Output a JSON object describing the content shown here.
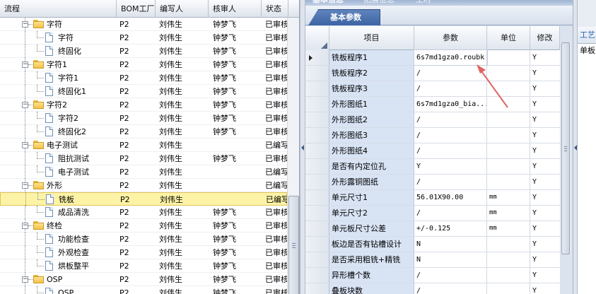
{
  "tree": {
    "columns": [
      "流程",
      "BOM工厂",
      "编写人",
      "核审人",
      "状态"
    ],
    "rows": [
      {
        "level": 1,
        "kind": "folder",
        "name": "字符",
        "bom": "P2",
        "writer": "刘伟生",
        "reviewer": "钟梦飞",
        "status": "已审核"
      },
      {
        "level": 2,
        "kind": "doc",
        "name": "字符",
        "bom": "P2",
        "writer": "刘伟生",
        "reviewer": "钟梦飞",
        "status": "已审核"
      },
      {
        "level": 2,
        "kind": "doc",
        "name": "终固化",
        "bom": "P2",
        "writer": "刘伟生",
        "reviewer": "钟梦飞",
        "status": "已审核"
      },
      {
        "level": 1,
        "kind": "folder",
        "name": "字符1",
        "bom": "P2",
        "writer": "刘伟生",
        "reviewer": "钟梦飞",
        "status": "已审核"
      },
      {
        "level": 2,
        "kind": "doc",
        "name": "字符1",
        "bom": "P2",
        "writer": "刘伟生",
        "reviewer": "钟梦飞",
        "status": "已审核"
      },
      {
        "level": 2,
        "kind": "doc",
        "name": "终固化1",
        "bom": "P2",
        "writer": "刘伟生",
        "reviewer": "钟梦飞",
        "status": "已审核"
      },
      {
        "level": 1,
        "kind": "folder",
        "name": "字符2",
        "bom": "P2",
        "writer": "刘伟生",
        "reviewer": "钟梦飞",
        "status": "已审核"
      },
      {
        "level": 2,
        "kind": "doc",
        "name": "字符2",
        "bom": "P2",
        "writer": "刘伟生",
        "reviewer": "钟梦飞",
        "status": "已审核"
      },
      {
        "level": 2,
        "kind": "doc",
        "name": "终固化2",
        "bom": "P2",
        "writer": "刘伟生",
        "reviewer": "钟梦飞",
        "status": "已审核"
      },
      {
        "level": 1,
        "kind": "folder",
        "name": "电子测试",
        "bom": "P2",
        "writer": "刘伟生",
        "reviewer": "",
        "status": "已编写"
      },
      {
        "level": 2,
        "kind": "doc",
        "name": "阻抗测试",
        "bom": "P2",
        "writer": "刘伟生",
        "reviewer": "钟梦飞",
        "status": "已审核"
      },
      {
        "level": 2,
        "kind": "doc",
        "name": "电子测试",
        "bom": "P2",
        "writer": "刘伟生",
        "reviewer": "",
        "status": "已编写"
      },
      {
        "level": 1,
        "kind": "folder",
        "name": "外形",
        "bom": "P2",
        "writer": "刘伟生",
        "reviewer": "",
        "status": "已编写"
      },
      {
        "level": 2,
        "kind": "doc",
        "name": "铣板",
        "bom": "P2",
        "writer": "刘伟生",
        "reviewer": "",
        "status": "已编写",
        "selected": true
      },
      {
        "level": 2,
        "kind": "doc",
        "name": "成品清洗",
        "bom": "P2",
        "writer": "刘伟生",
        "reviewer": "钟梦飞",
        "status": "已审核"
      },
      {
        "level": 1,
        "kind": "folder",
        "name": "终检",
        "bom": "P2",
        "writer": "刘伟生",
        "reviewer": "钟梦飞",
        "status": "已审核"
      },
      {
        "level": 2,
        "kind": "doc",
        "name": "功能检查",
        "bom": "P2",
        "writer": "刘伟生",
        "reviewer": "钟梦飞",
        "status": "已审核"
      },
      {
        "level": 2,
        "kind": "doc",
        "name": "外观检查",
        "bom": "P2",
        "writer": "刘伟生",
        "reviewer": "钟梦飞",
        "status": "已审核"
      },
      {
        "level": 2,
        "kind": "doc",
        "name": "烘板整平",
        "bom": "P2",
        "writer": "刘伟生",
        "reviewer": "钟梦飞",
        "status": "已审核"
      },
      {
        "level": 1,
        "kind": "folder",
        "name": "OSP",
        "bom": "P2",
        "writer": "刘伟生",
        "reviewer": "钟梦飞",
        "status": "已审核"
      },
      {
        "level": 2,
        "kind": "doc",
        "name": "OSP",
        "bom": "P2",
        "writer": "刘伟生",
        "reviewer": "钟梦飞",
        "status": "已审核"
      }
    ]
  },
  "right": {
    "tabs": [
      "基本信息",
      "拓展信息",
      "工时"
    ],
    "subtab": "基本参数",
    "columns": [
      "项目",
      "参数",
      "单位",
      "修改"
    ],
    "rows": [
      {
        "item": "铣板程序1",
        "param": "6s7md1gza0.roubk",
        "unit": "",
        "mod": "Y",
        "current": true
      },
      {
        "item": "铣板程序2",
        "param": "/",
        "unit": "",
        "mod": "Y"
      },
      {
        "item": "铣板程序3",
        "param": "/",
        "unit": "",
        "mod": "Y"
      },
      {
        "item": "外形图纸1",
        "param": "6s7md1gza0_bia...",
        "unit": "",
        "mod": "Y"
      },
      {
        "item": "外形图纸2",
        "param": "/",
        "unit": "",
        "mod": "Y"
      },
      {
        "item": "外形图纸3",
        "param": "/",
        "unit": "",
        "mod": "Y"
      },
      {
        "item": "外形图纸4",
        "param": "/",
        "unit": "",
        "mod": "Y"
      },
      {
        "item": "是否有内定位孔",
        "param": "Y",
        "unit": "",
        "mod": "Y"
      },
      {
        "item": "外形露铜图纸",
        "param": "/",
        "unit": "",
        "mod": "Y"
      },
      {
        "item": "单元尺寸1",
        "param": "56.01X90.00",
        "unit": "mm",
        "mod": "Y"
      },
      {
        "item": "单元尺寸2",
        "param": "/",
        "unit": "mm",
        "mod": "Y"
      },
      {
        "item": "单元板尺寸公差",
        "param": "+/-0.125",
        "unit": "mm",
        "mod": "Y"
      },
      {
        "item": "板边是否有钻槽设计",
        "param": "N",
        "unit": "",
        "mod": "Y"
      },
      {
        "item": "是否采用粗铣+精铣",
        "param": "N",
        "unit": "",
        "mod": "Y"
      },
      {
        "item": "异形槽个数",
        "param": "/",
        "unit": "",
        "mod": "Y"
      },
      {
        "item": "叠板块数",
        "param": "/",
        "unit": "",
        "mod": "Y"
      }
    ]
  },
  "far": {
    "header": "工艺",
    "row": "单板"
  },
  "colors": {
    "selected_row": "#fdf3a6",
    "subtab": "#4a70ad",
    "annotation_arrow": "#e06464"
  }
}
